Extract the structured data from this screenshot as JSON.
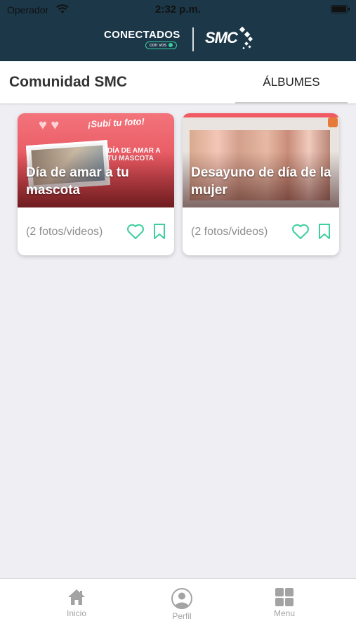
{
  "status_bar": {
    "carrier": "Operador",
    "time": "2:32 p.m."
  },
  "header": {
    "brand_primary": "CONECTADOS",
    "brand_tagline": "con vos",
    "brand_secondary": "SMC"
  },
  "topbar": {
    "title": "Comunidad SMC",
    "active_tab": "ÁLBUMES"
  },
  "albums": [
    {
      "title": "Día de amar a tu mascota",
      "count": "(2 fotos/videos)",
      "thumb_badge": "¡Subí tu foto!",
      "thumb_subtitle": "DÍA DE AMAR A TU MASCOTA"
    },
    {
      "title": "Desayuno de día de la mujer",
      "count": "(2 fotos/videos)"
    }
  ],
  "tab_bar": {
    "items": [
      {
        "label": "Inicio",
        "icon": "home-icon"
      },
      {
        "label": "Perfil",
        "icon": "profile-icon"
      },
      {
        "label": "Menu",
        "icon": "grid-menu-icon"
      }
    ]
  },
  "colors": {
    "header_bg": "#1b3748",
    "accent_teal": "#3ccf9f",
    "page_bg": "#eeeef3"
  }
}
